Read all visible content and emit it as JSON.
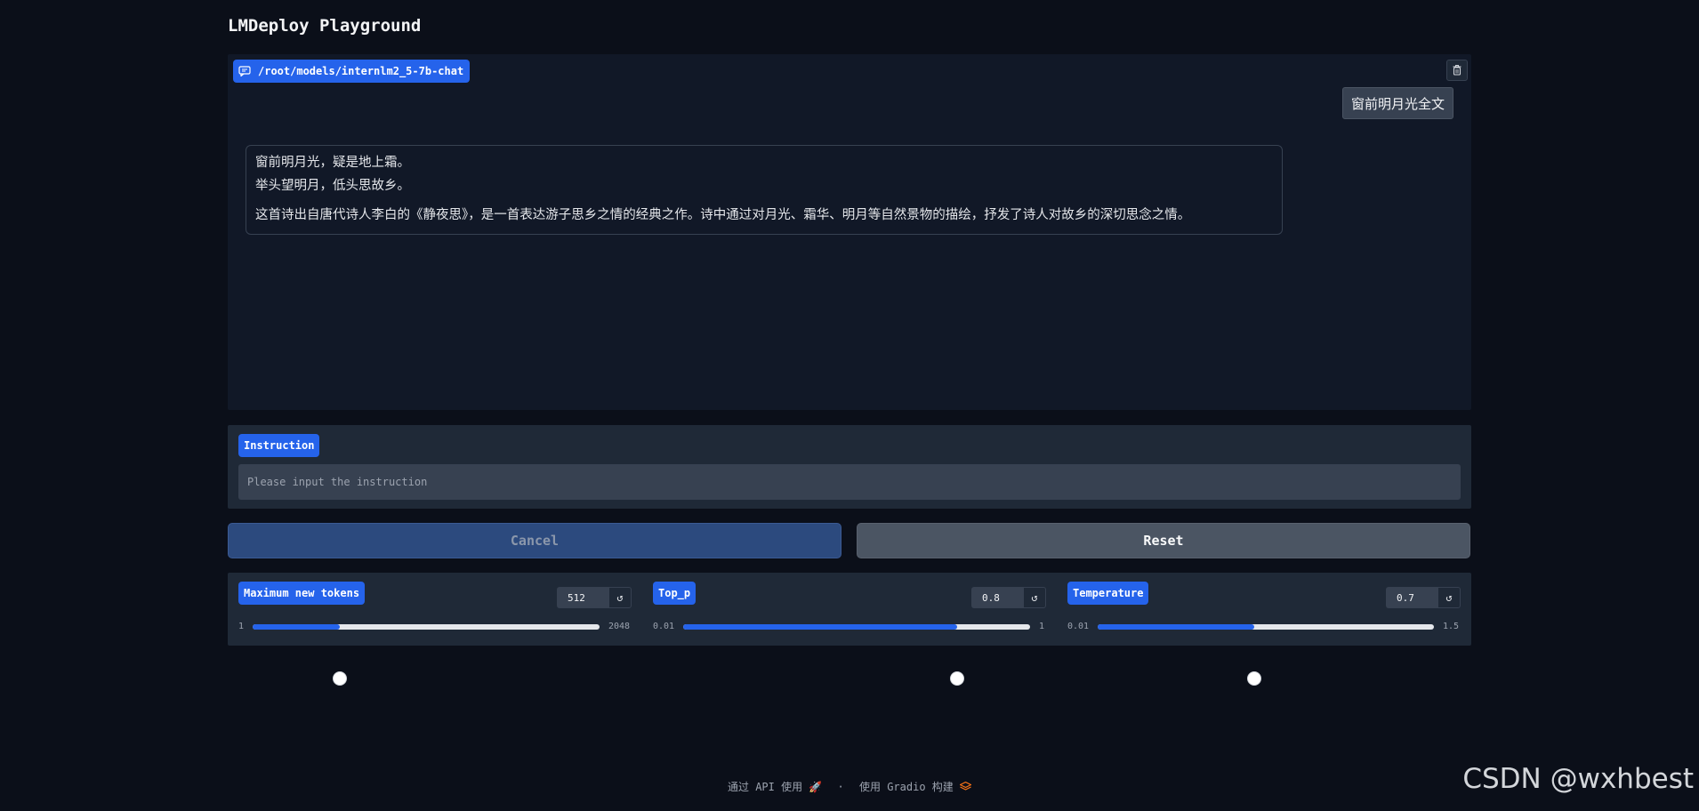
{
  "app": {
    "title": "LMDeploy Playground"
  },
  "chatbot": {
    "label": "/root/models/internlm2_5-7b-chat",
    "user_message": "窗前明月光全文",
    "bot_message": {
      "line1": "窗前明月光，疑是地上霜。",
      "line2": "举头望明月，低头思故乡。",
      "line3": "这首诗出自唐代诗人李白的《静夜思》，是一首表达游子思乡之情的经典之作。诗中通过对月光、霜华、明月等自然景物的描绘，抒发了诗人对故乡的深切思念之情。"
    },
    "clear_icon": "trash-icon"
  },
  "instruction": {
    "label": "Instruction",
    "placeholder": "Please input the instruction",
    "value": ""
  },
  "buttons": {
    "cancel": "Cancel",
    "reset": "Reset"
  },
  "sliders": [
    {
      "label": "Maximum new tokens",
      "value": "512",
      "min": "1",
      "max": "2048",
      "fraction": 0.25
    },
    {
      "label": "Top_p",
      "value": "0.8",
      "min": "0.01",
      "max": "1",
      "fraction": 0.79
    },
    {
      "label": "Temperature",
      "value": "0.7",
      "min": "0.01",
      "max": "1.5",
      "fraction": 0.465
    }
  ],
  "footer": {
    "api_text": "通过 API 使用",
    "api_icon": "rocket-icon",
    "separator": "·",
    "built_text": "使用 Gradio 构建",
    "gradio_icon": "gradio-logo-icon"
  },
  "watermark": "CSDN @wxhbest",
  "colors": {
    "accent": "#2563eb",
    "background": "#0b0f19",
    "panel": "#111827",
    "block": "#1f2937"
  }
}
